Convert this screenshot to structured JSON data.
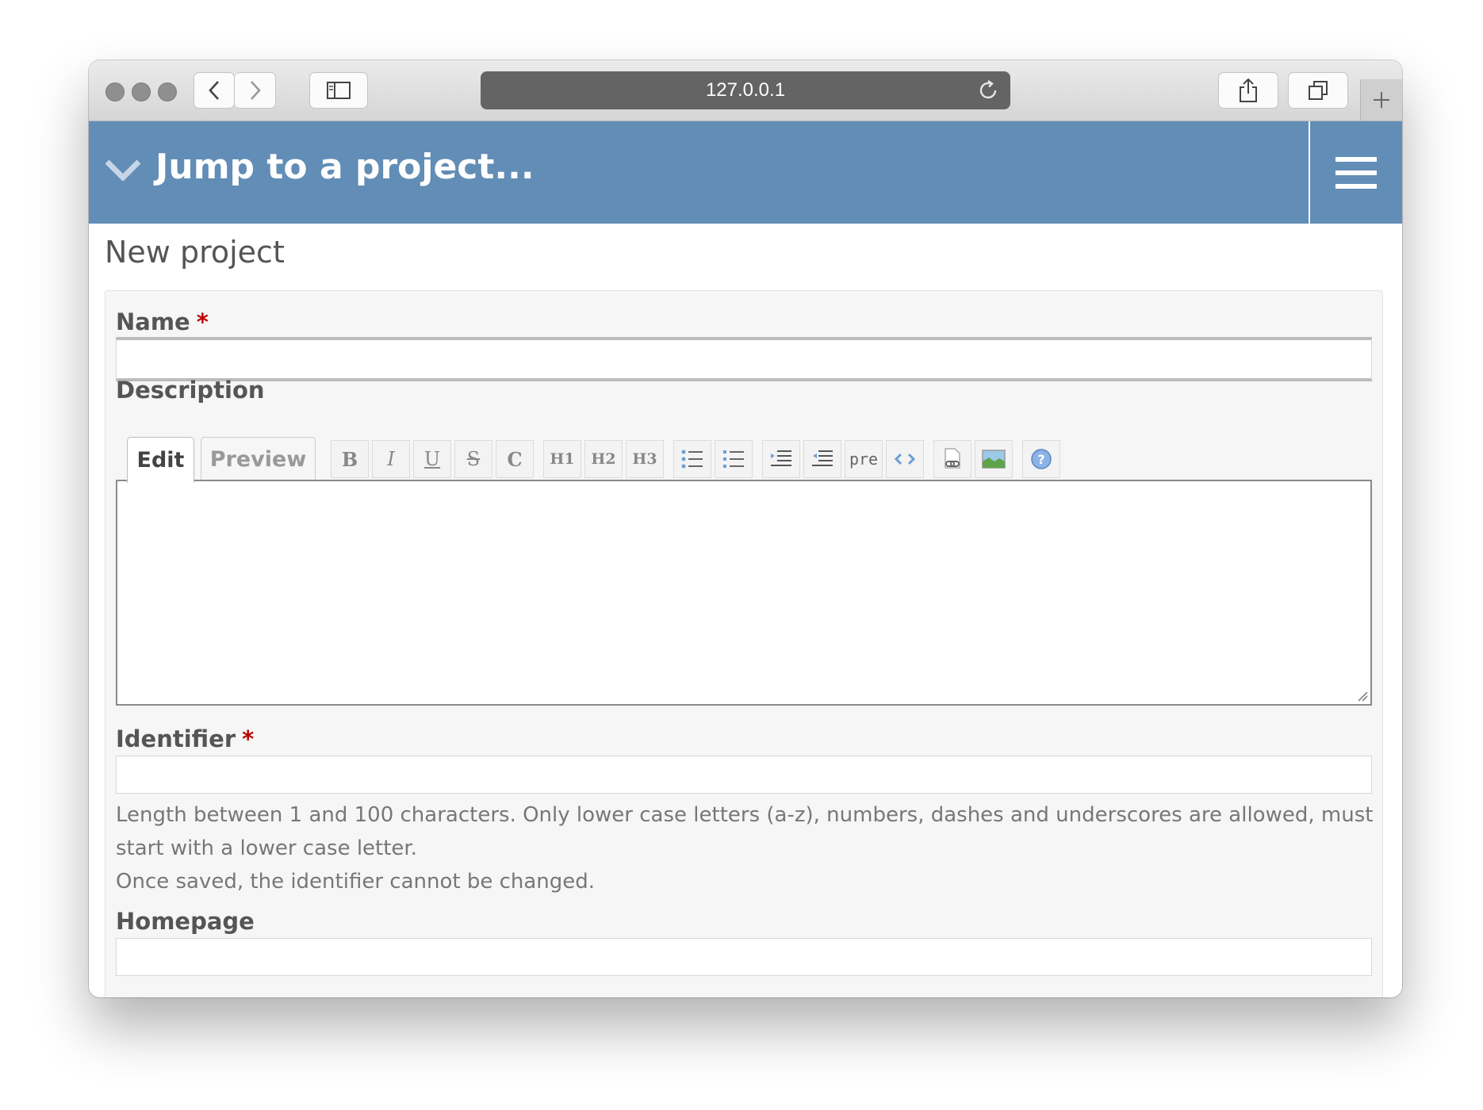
{
  "browser": {
    "url": "127.0.0.1"
  },
  "header": {
    "jump_label": "Jump to a project..."
  },
  "page": {
    "title": "New project"
  },
  "form": {
    "name_label": "Name",
    "required_mark": "*",
    "description_label": "Description",
    "tabs": {
      "edit": "Edit",
      "preview": "Preview"
    },
    "toolbar": {
      "bold": "B",
      "italic": "I",
      "underline": "U",
      "strike": "S",
      "code": "C",
      "h1": "H1",
      "h2": "H2",
      "h3": "H3",
      "pre": "pre"
    },
    "identifier_label": "Identifier",
    "identifier_hint_1": "Length between 1 and 100 characters. Only lower case letters (a-z), numbers, dashes and underscores are allowed, must start with a lower case letter.",
    "identifier_hint_2": "Once saved, the identifier cannot be changed.",
    "homepage_label": "Homepage"
  },
  "icons": {
    "nav": [
      "back-icon",
      "forward-icon",
      "sidebar-icon",
      "reload-icon",
      "share-icon",
      "tabs-icon",
      "new-tab-icon"
    ],
    "header": [
      "chevron-down-icon",
      "hamburger-menu-icon"
    ],
    "toolbar": [
      "unordered-list-icon",
      "ordered-list-icon",
      "indent-icon",
      "outdent-icon",
      "inline-code-icon",
      "link-icon",
      "image-icon",
      "help-icon"
    ]
  },
  "colors": {
    "header_bg": "#628db6",
    "required": "#bb0000",
    "url_bar": "#646464"
  }
}
